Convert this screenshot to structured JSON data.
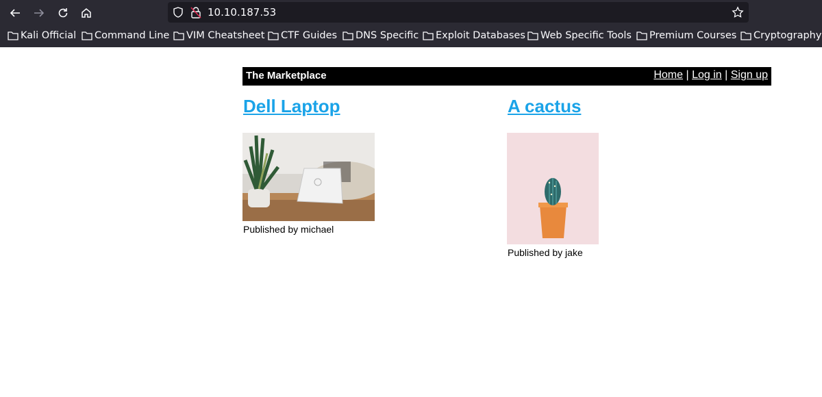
{
  "browser": {
    "url": "10.10.187.53",
    "bookmarks": [
      "Kali Official",
      "Command Line",
      "VIM Cheatsheet",
      "CTF Guides",
      "DNS Specific",
      "Exploit Databases",
      "Web Specific Tools",
      "Premium Courses",
      "Cryptography"
    ]
  },
  "site": {
    "title": "The Marketplace",
    "nav": {
      "home": "Home",
      "login": "Log in",
      "signup": "Sign up",
      "separator": "|"
    }
  },
  "listings": [
    {
      "title": "Dell Laptop",
      "publisher": "Published by michael",
      "image": "laptop-photo"
    },
    {
      "title": "A cactus",
      "publisher": "Published by jake",
      "image": "cactus-photo"
    }
  ],
  "colors": {
    "chrome": "#2b2a33",
    "urlbar": "#1c1b22",
    "header": "#000000",
    "link": "#1aa3e8"
  }
}
